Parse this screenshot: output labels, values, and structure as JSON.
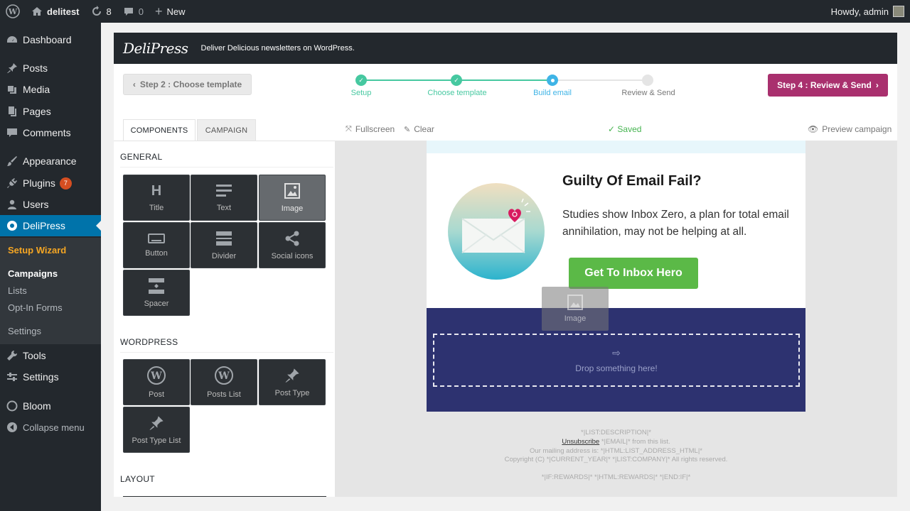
{
  "adminbar": {
    "site_name": "delitest",
    "updates_count": "8",
    "comments_count": "0",
    "new_label": "New",
    "greeting": "Howdy, admin"
  },
  "sidebar": {
    "items": [
      {
        "label": "Dashboard",
        "icon": "dashboard-icon"
      },
      {
        "label": "Posts",
        "icon": "pin-icon"
      },
      {
        "label": "Media",
        "icon": "media-icon"
      },
      {
        "label": "Pages",
        "icon": "pages-icon"
      },
      {
        "label": "Comments",
        "icon": "comment-icon"
      },
      {
        "label": "Appearance",
        "icon": "brush-icon"
      },
      {
        "label": "Plugins",
        "icon": "plugin-icon",
        "badge": "7"
      },
      {
        "label": "Users",
        "icon": "users-icon"
      },
      {
        "label": "DeliPress",
        "icon": "delipress-icon"
      },
      {
        "label": "Tools",
        "icon": "wrench-icon"
      },
      {
        "label": "Settings",
        "icon": "settings-icon"
      },
      {
        "label": "Bloom",
        "icon": "bloom-icon"
      },
      {
        "label": "Collapse menu",
        "icon": "collapse-icon"
      }
    ],
    "submenu": [
      "Setup Wizard",
      "Campaigns",
      "Lists",
      "Opt-In Forms",
      "Settings"
    ]
  },
  "brand": {
    "logo": "DeliPress",
    "tagline": "Deliver Delicious newsletters on WordPress."
  },
  "wizard": {
    "prev_label": "Step 2 : Choose template",
    "next_label": "Step 4 : Review & Send",
    "steps": [
      "Setup",
      "Choose template",
      "Build email",
      "Review & Send"
    ],
    "current_step": 3
  },
  "tabs": {
    "components": "COMPONENTS",
    "campaign": "CAMPAIGN"
  },
  "toolbar": {
    "fullscreen": "Fullscreen",
    "clear": "Clear",
    "saved": "Saved",
    "preview": "Preview campaign"
  },
  "components": {
    "general_title": "GENERAL",
    "general": [
      "Title",
      "Text",
      "Image",
      "Button",
      "Divider",
      "Social icons",
      "Spacer"
    ],
    "wordpress_title": "WORDPRESS",
    "wordpress": [
      "Post",
      "Posts List",
      "Post Type",
      "Post Type List"
    ],
    "layout_title": "LAYOUT"
  },
  "email": {
    "heading": "Guilty Of Email Fail?",
    "body": "Studies show Inbox Zero, a plan for total email annihilation, may not be helping at all.",
    "cta": "Get To Inbox Hero",
    "drop_label": "Drop something here!",
    "ghost_label": "Image",
    "footer": {
      "line1": "*|LIST:DESCRIPTION|*",
      "unsubscribe": "Unsubscribe",
      "line2": " *|EMAIL|* from this list.",
      "line3": "Our mailing address is: *|HTML:LIST_ADDRESS_HTML|*",
      "line4": "Copyright (C) *|CURRENT_YEAR|* *|LIST:COMPANY|* All rights reserved.",
      "line5": "*|IF:REWARDS|* *|HTML:REWARDS|* *|END:IF|*"
    }
  },
  "colors": {
    "wp_dark": "#23282d",
    "wp_blue": "#0073aa",
    "step_green": "#46c8a0",
    "step_blue": "#3fb4e6",
    "next_button": "#a9306e",
    "cta_green": "#5bb947",
    "email_band": "#2d3270"
  }
}
